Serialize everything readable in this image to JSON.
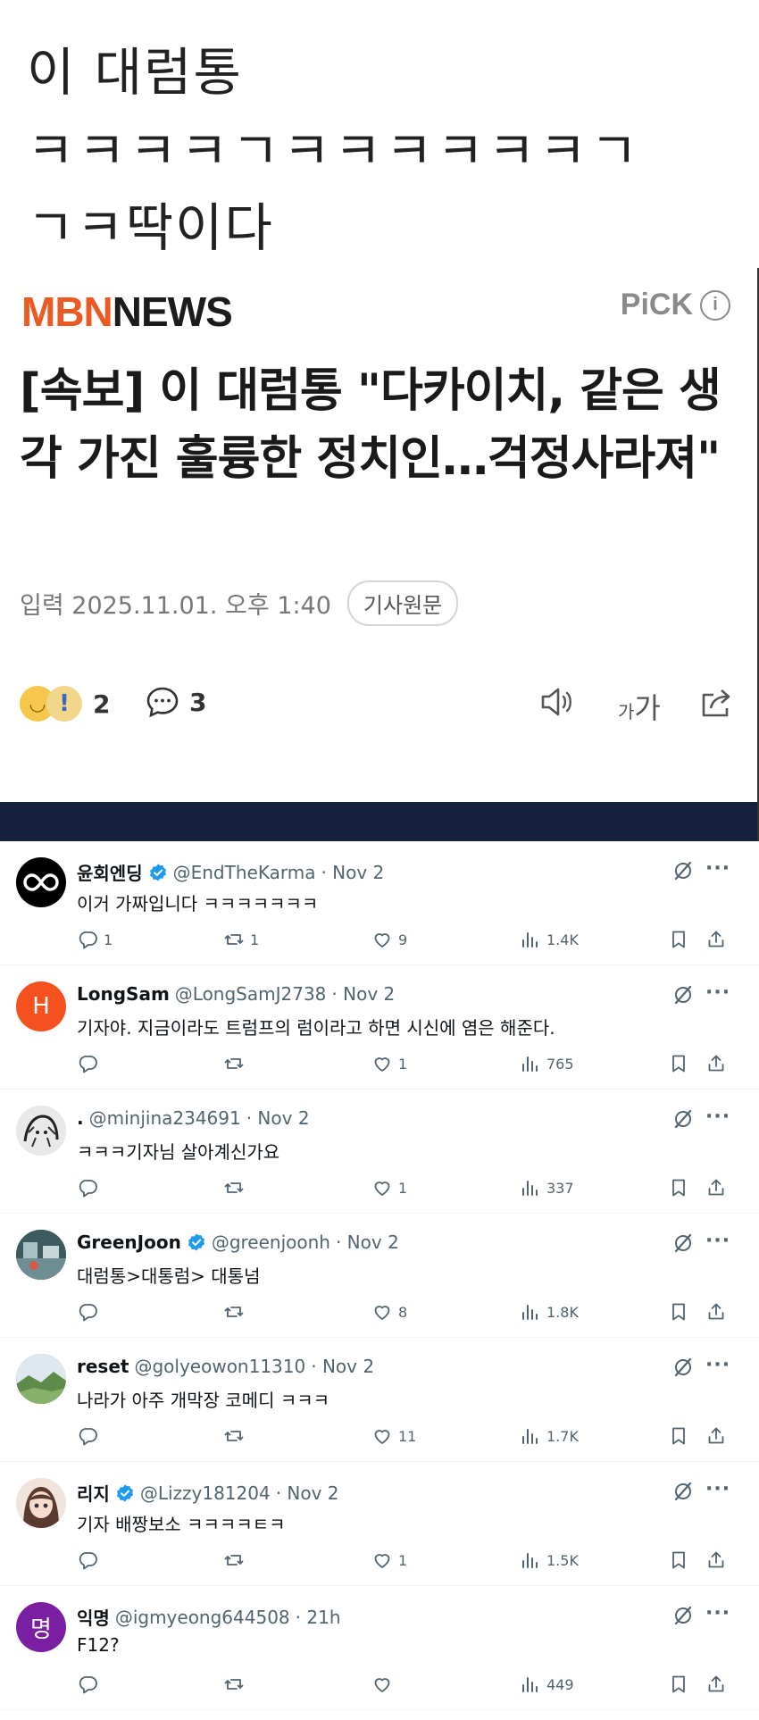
{
  "caption": {
    "line1": "이 대럼통",
    "line2": "ㅋㅋㅋㅋㄱㅋㅋㅋㅋㅋㅋㄱ",
    "line3": "ㄱㅋ딱이다"
  },
  "article": {
    "brand_mbn": "MBN",
    "brand_news": "NEWS",
    "pick_label": "PiCK",
    "info_glyph": "i",
    "headline": "[속보] 이 대럼통 \"다카이치, 같은 생각 가진 훌륭한 정치인…걱정사라져\"",
    "published": "입력 2025.11.01. 오후 1:40",
    "original_button": "기사원문",
    "reaction_count": "2",
    "comment_count": "3",
    "fontsize_small": "가",
    "fontsize_large": "가",
    "colors": {
      "brand_orange": "#ec5a24",
      "band": "#15203d"
    }
  },
  "tweets": [
    {
      "name": "윤회엔딩",
      "verified": true,
      "handle": "@EndTheKarma",
      "date": "· Nov 2",
      "text": "이거 가짜입니다 ㅋㅋㅋㅋㅋㅋㅋ",
      "replies": "1",
      "reposts": "1",
      "likes": "9",
      "views": "1.4K",
      "avatar": "infinity-icon",
      "avatar_letter": "",
      "avatar_color": "#000000"
    },
    {
      "name": "LongSam",
      "verified": false,
      "handle": "@LongSamJ2738",
      "date": "· Nov 2",
      "text": "기자야. 지금이라도 트럼프의 럼이라고 하면 시신에 염은 해준다.",
      "replies": "",
      "reposts": "",
      "likes": "1",
      "views": "765",
      "avatar": "letter",
      "avatar_letter": "H",
      "avatar_color": "#f4511e"
    },
    {
      "name": ".",
      "verified": false,
      "handle": "@minjina234691",
      "date": "· Nov 2",
      "text": "ㅋㅋㅋ기자님 살아계신가요",
      "replies": "",
      "reposts": "",
      "likes": "1",
      "views": "337",
      "avatar": "sketch",
      "avatar_letter": "",
      "avatar_color": "#cfcfcf"
    },
    {
      "name": "GreenJoon",
      "verified": true,
      "handle": "@greenjoonh",
      "date": "· Nov 2",
      "text": "대럼통>대통럼> 대통넘",
      "replies": "",
      "reposts": "",
      "likes": "8",
      "views": "1.8K",
      "avatar": "photo",
      "avatar_letter": "",
      "avatar_color": "#4a6b6e"
    },
    {
      "name": "reset",
      "verified": false,
      "handle": "@golyeowon11310",
      "date": "· Nov 2",
      "text": "나라가 아주 개막장 코메디 ㅋㅋㅋ",
      "replies": "",
      "reposts": "",
      "likes": "11",
      "views": "1.7K",
      "avatar": "landscape",
      "avatar_letter": "",
      "avatar_color": "#6e9a5a"
    },
    {
      "name": "리지",
      "verified": true,
      "handle": "@Lizzy181204",
      "date": "· Nov 2",
      "text": "기자 배짱보소 ㅋㅋㅋㅋㅌㅋ",
      "replies": "",
      "reposts": "",
      "likes": "1",
      "views": "1.5K",
      "avatar": "anime",
      "avatar_letter": "",
      "avatar_color": "#e9d8cf"
    },
    {
      "name": "익명",
      "verified": false,
      "handle": "@igmyeong644508",
      "date": "· 21h",
      "text": "F12?",
      "replies": "",
      "reposts": "",
      "likes": "",
      "views": "449",
      "avatar": "letter",
      "avatar_letter": "명",
      "avatar_color": "#7b1fa2"
    }
  ]
}
